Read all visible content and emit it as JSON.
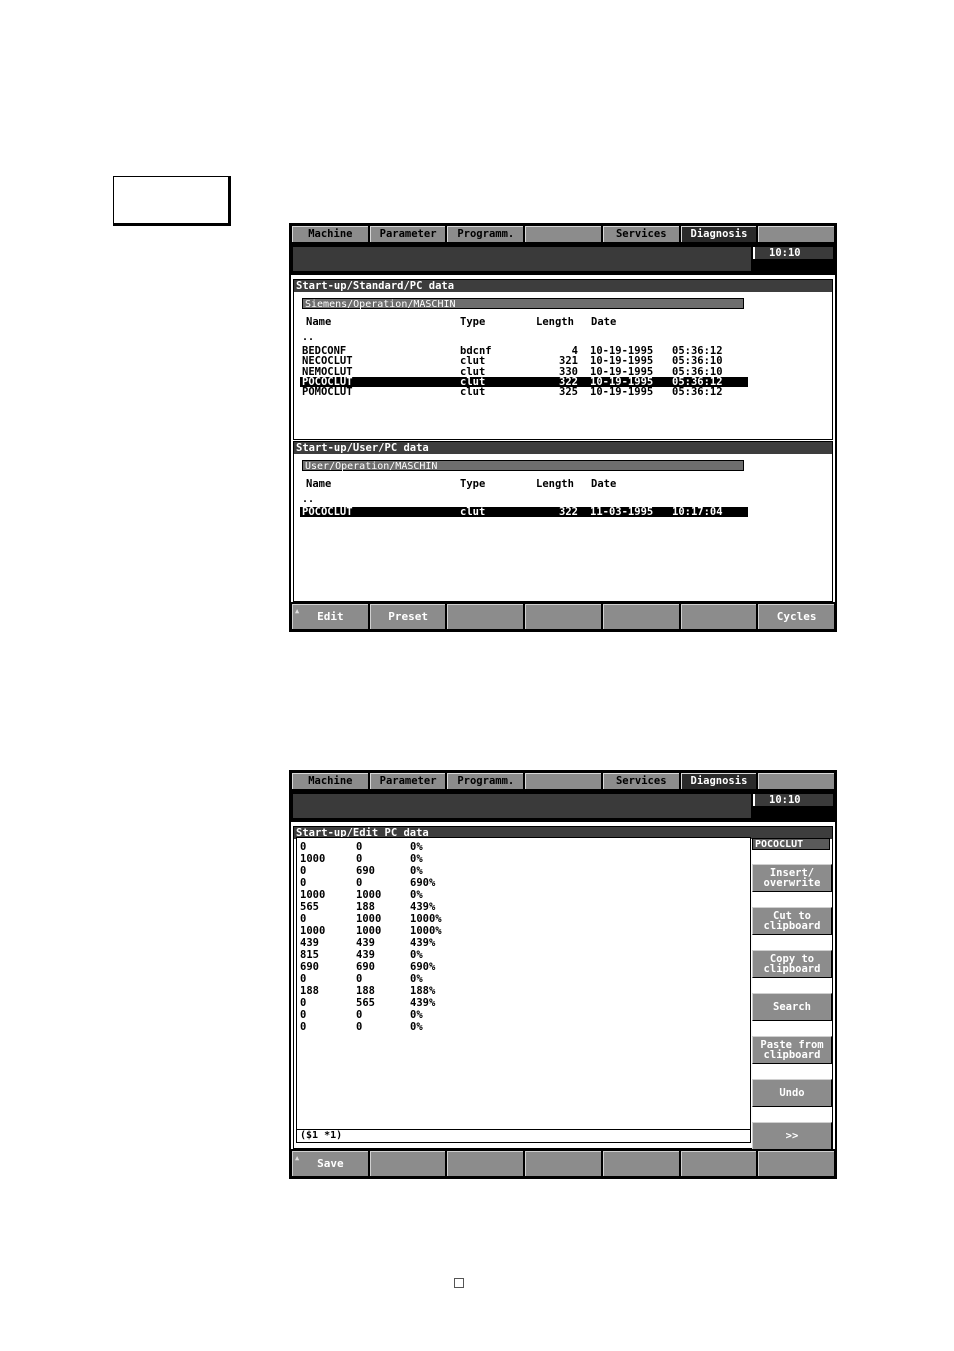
{
  "tabs": [
    "Machine",
    "Parameter",
    "Programm.",
    "",
    "Services",
    "Diagnosis",
    ""
  ],
  "clock": "10:10",
  "screen1": {
    "panel_top": {
      "title": "Start-up/Standard/PC data",
      "path": "Siemens/Operation/MASCHIN",
      "headers": {
        "name": "Name",
        "type": "Type",
        "length": "Length",
        "date": "Date"
      },
      "dots": "..",
      "rows": [
        {
          "name": "BEDCONF",
          "type": "bdcnf",
          "length": "4",
          "date": "10-19-1995",
          "time": "05:36:12"
        },
        {
          "name": "NECOCLUT",
          "type": "clut",
          "length": "321",
          "date": "10-19-1995",
          "time": "05:36:10"
        },
        {
          "name": "NEMOCLUT",
          "type": "clut",
          "length": "330",
          "date": "10-19-1995",
          "time": "05:36:10"
        },
        {
          "name": "POCOCLUT",
          "type": "clut",
          "length": "322",
          "date": "10-19-1995",
          "time": "05:36:12"
        },
        {
          "name": "POMOCLUT",
          "type": "clut",
          "length": "325",
          "date": "10-19-1995",
          "time": "05:36:12"
        }
      ]
    },
    "panel_bottom": {
      "title": "Start-up/User/PC data",
      "path": "User/Operation/MASCHIN",
      "headers": {
        "name": "Name",
        "type": "Type",
        "length": "Length",
        "date": "Date"
      },
      "dots": "..",
      "rows": [
        {
          "name": "POCOCLUT",
          "type": "clut",
          "length": "322",
          "date": "11-03-1995",
          "time": "10:17:04"
        }
      ]
    },
    "softkeys": [
      "Edit",
      "Preset",
      "",
      "",
      "",
      "",
      "Cycles"
    ]
  },
  "screen2": {
    "title": "Start-up/Edit PC data",
    "file_name": "POCOCLUT",
    "editor_rows": [
      [
        "0",
        "0",
        "0%"
      ],
      [
        "1000",
        "0",
        "0%"
      ],
      [
        "0",
        "690",
        "0%"
      ],
      [
        "0",
        "0",
        "690%"
      ],
      [
        "1000",
        "1000",
        "0%"
      ],
      [
        "565",
        "188",
        "439%"
      ],
      [
        "0",
        "1000",
        "1000%"
      ],
      [
        "1000",
        "1000",
        "1000%"
      ],
      [
        "439",
        "439",
        "439%"
      ],
      [
        "815",
        "439",
        "0%"
      ],
      [
        "690",
        "690",
        "690%"
      ],
      [
        "0",
        "0",
        "0%"
      ],
      [
        "188",
        "188",
        "188%"
      ],
      [
        "0",
        "565",
        "439%"
      ],
      [
        "0",
        "0",
        "0%"
      ],
      [
        "0",
        "0",
        "0%"
      ]
    ],
    "status": "($1 *1)",
    "vkeys": [
      [
        "Insert/",
        "overwrite"
      ],
      [
        "Cut to",
        "clipboard"
      ],
      [
        "Copy to",
        "clipboard"
      ],
      [
        "Search"
      ],
      [
        "Paste from",
        "clipboard"
      ],
      [
        "Undo"
      ],
      [
        ">>"
      ]
    ],
    "softkeys": [
      "Save",
      "",
      "",
      "",
      "",
      "",
      ""
    ]
  }
}
